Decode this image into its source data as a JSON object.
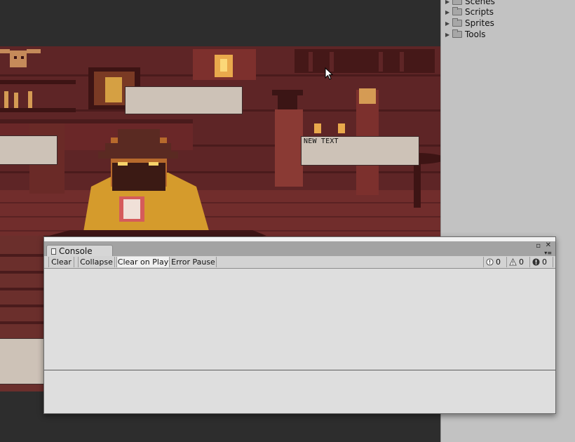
{
  "project": {
    "folders": [
      {
        "label": "Scenes"
      },
      {
        "label": "Scripts"
      },
      {
        "label": "Sprites"
      },
      {
        "label": "Tools"
      }
    ]
  },
  "game": {
    "textboxes": [
      {
        "text": ""
      },
      {
        "text": ""
      },
      {
        "text": "NEW TEXT"
      },
      {
        "text": ""
      },
      {
        "text": ""
      }
    ]
  },
  "console": {
    "tab_label": "Console",
    "toolbar": {
      "clear": "Clear",
      "collapse": "Collapse",
      "clear_on_play": "Clear on Play",
      "error_pause": "Error Pause"
    },
    "counts": {
      "info": "0",
      "warning": "0",
      "error": "0"
    }
  }
}
